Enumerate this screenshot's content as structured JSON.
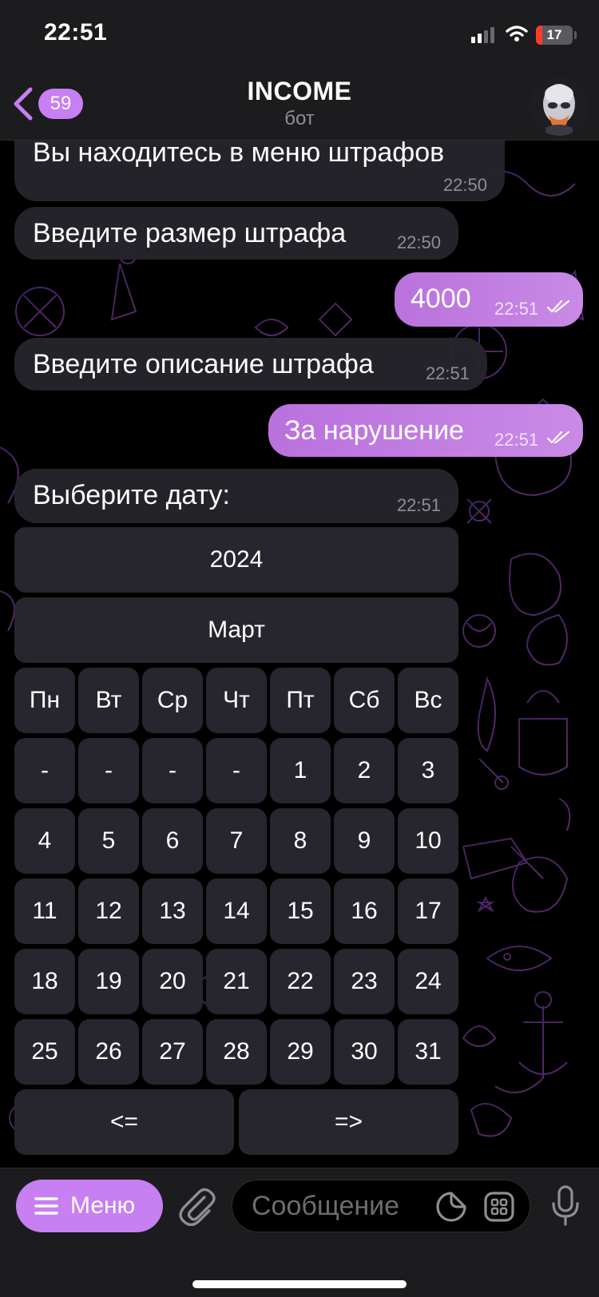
{
  "status_bar": {
    "time": "22:51",
    "battery": "17",
    "battery_level": 0.17
  },
  "header": {
    "back_count": "59",
    "title": "INCOME",
    "subtitle": "бот",
    "back_icon": "chevron-left-icon",
    "avatar_icon": "bot-avatar"
  },
  "messages": [
    {
      "dir": "in",
      "text": "Вы находитесь в меню штрафов",
      "time": "22:50"
    },
    {
      "dir": "in",
      "text": "Введите размер штрафа",
      "time": "22:50"
    },
    {
      "dir": "out",
      "text": "4000",
      "time": "22:51",
      "read": true
    },
    {
      "dir": "in",
      "text": "Введите описание штрафа",
      "time": "22:51"
    },
    {
      "dir": "out",
      "text": "За нарушение",
      "time": "22:51",
      "read": true
    },
    {
      "dir": "in",
      "text": "Выберите дату:",
      "time": "22:51"
    }
  ],
  "calendar": {
    "year": "2024",
    "month": "Март",
    "weekdays": [
      "Пн",
      "Вт",
      "Ср",
      "Чт",
      "Пт",
      "Сб",
      "Вс"
    ],
    "weeks": [
      [
        "-",
        "-",
        "-",
        "-",
        "1",
        "2",
        "3"
      ],
      [
        "4",
        "5",
        "6",
        "7",
        "8",
        "9",
        "10"
      ],
      [
        "11",
        "12",
        "13",
        "14",
        "15",
        "16",
        "17"
      ],
      [
        "18",
        "19",
        "20",
        "21",
        "22",
        "23",
        "24"
      ],
      [
        "25",
        "26",
        "27",
        "28",
        "29",
        "30",
        "31"
      ]
    ],
    "prev": "<=",
    "next": "=>"
  },
  "bottom_bar": {
    "menu_label": "Меню",
    "placeholder": "Сообщение"
  },
  "colors": {
    "accent": "#c77ff2",
    "outgoing_bubble": "#c07de3",
    "incoming_bubble": "#26242c",
    "background": "#000000",
    "bar": "#1c1c1e"
  }
}
